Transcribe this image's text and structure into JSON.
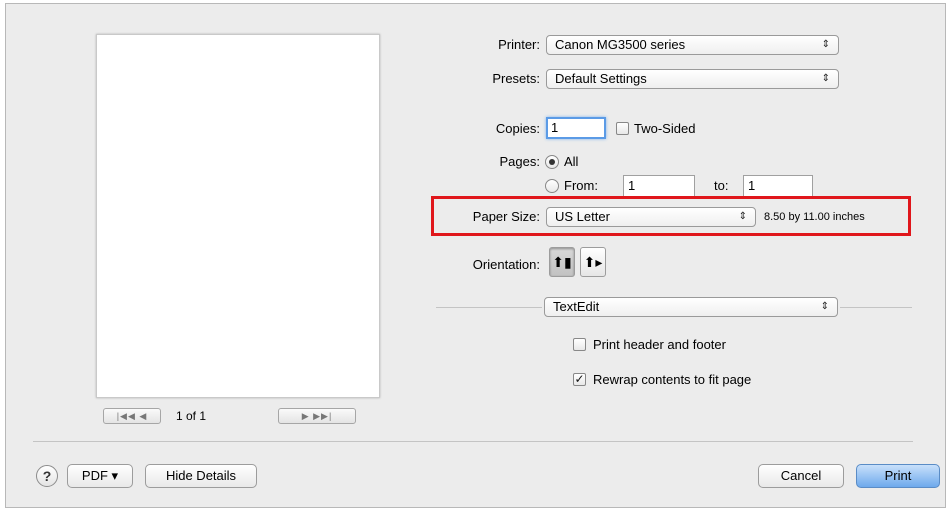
{
  "printer": {
    "label": "Printer:",
    "value": "Canon MG3500 series"
  },
  "presets": {
    "label": "Presets:",
    "value": "Default Settings"
  },
  "copies": {
    "label": "Copies:",
    "value": "1",
    "two_sided_label": "Two-Sided",
    "two_sided_checked": false
  },
  "pages": {
    "label": "Pages:",
    "all_label": "All",
    "from_label": "From:",
    "from_value": "1",
    "to_label": "to:",
    "to_value": "1",
    "selected": "All"
  },
  "paper_size": {
    "label": "Paper Size:",
    "value": "US Letter",
    "dimensions": "8.50 by 11.00 inches"
  },
  "orientation": {
    "label": "Orientation:",
    "selected": "portrait",
    "portrait_icon": "portrait-orientation-icon",
    "landscape_icon": "landscape-orientation-icon"
  },
  "section": {
    "value": "TextEdit"
  },
  "options": {
    "print_header_footer": {
      "label": "Print header and footer",
      "checked": false
    },
    "rewrap": {
      "label": "Rewrap contents to fit page",
      "checked": true
    }
  },
  "preview": {
    "page_indicator": "1 of 1"
  },
  "footer": {
    "help_symbol": "?",
    "pdf_label": "PDF ▾",
    "hide_details_label": "Hide Details",
    "cancel_label": "Cancel",
    "print_label": "Print"
  },
  "glyphs": {
    "popup_arrows": "⇕",
    "check": "✓",
    "first": "|◀◀",
    "prev": "◀",
    "next": "▶",
    "last": "▶▶|",
    "portrait": "⬆▮",
    "landscape": "⬆▸"
  },
  "colors": {
    "highlight": "#e0161b",
    "default_button": "#6ea9ec"
  }
}
